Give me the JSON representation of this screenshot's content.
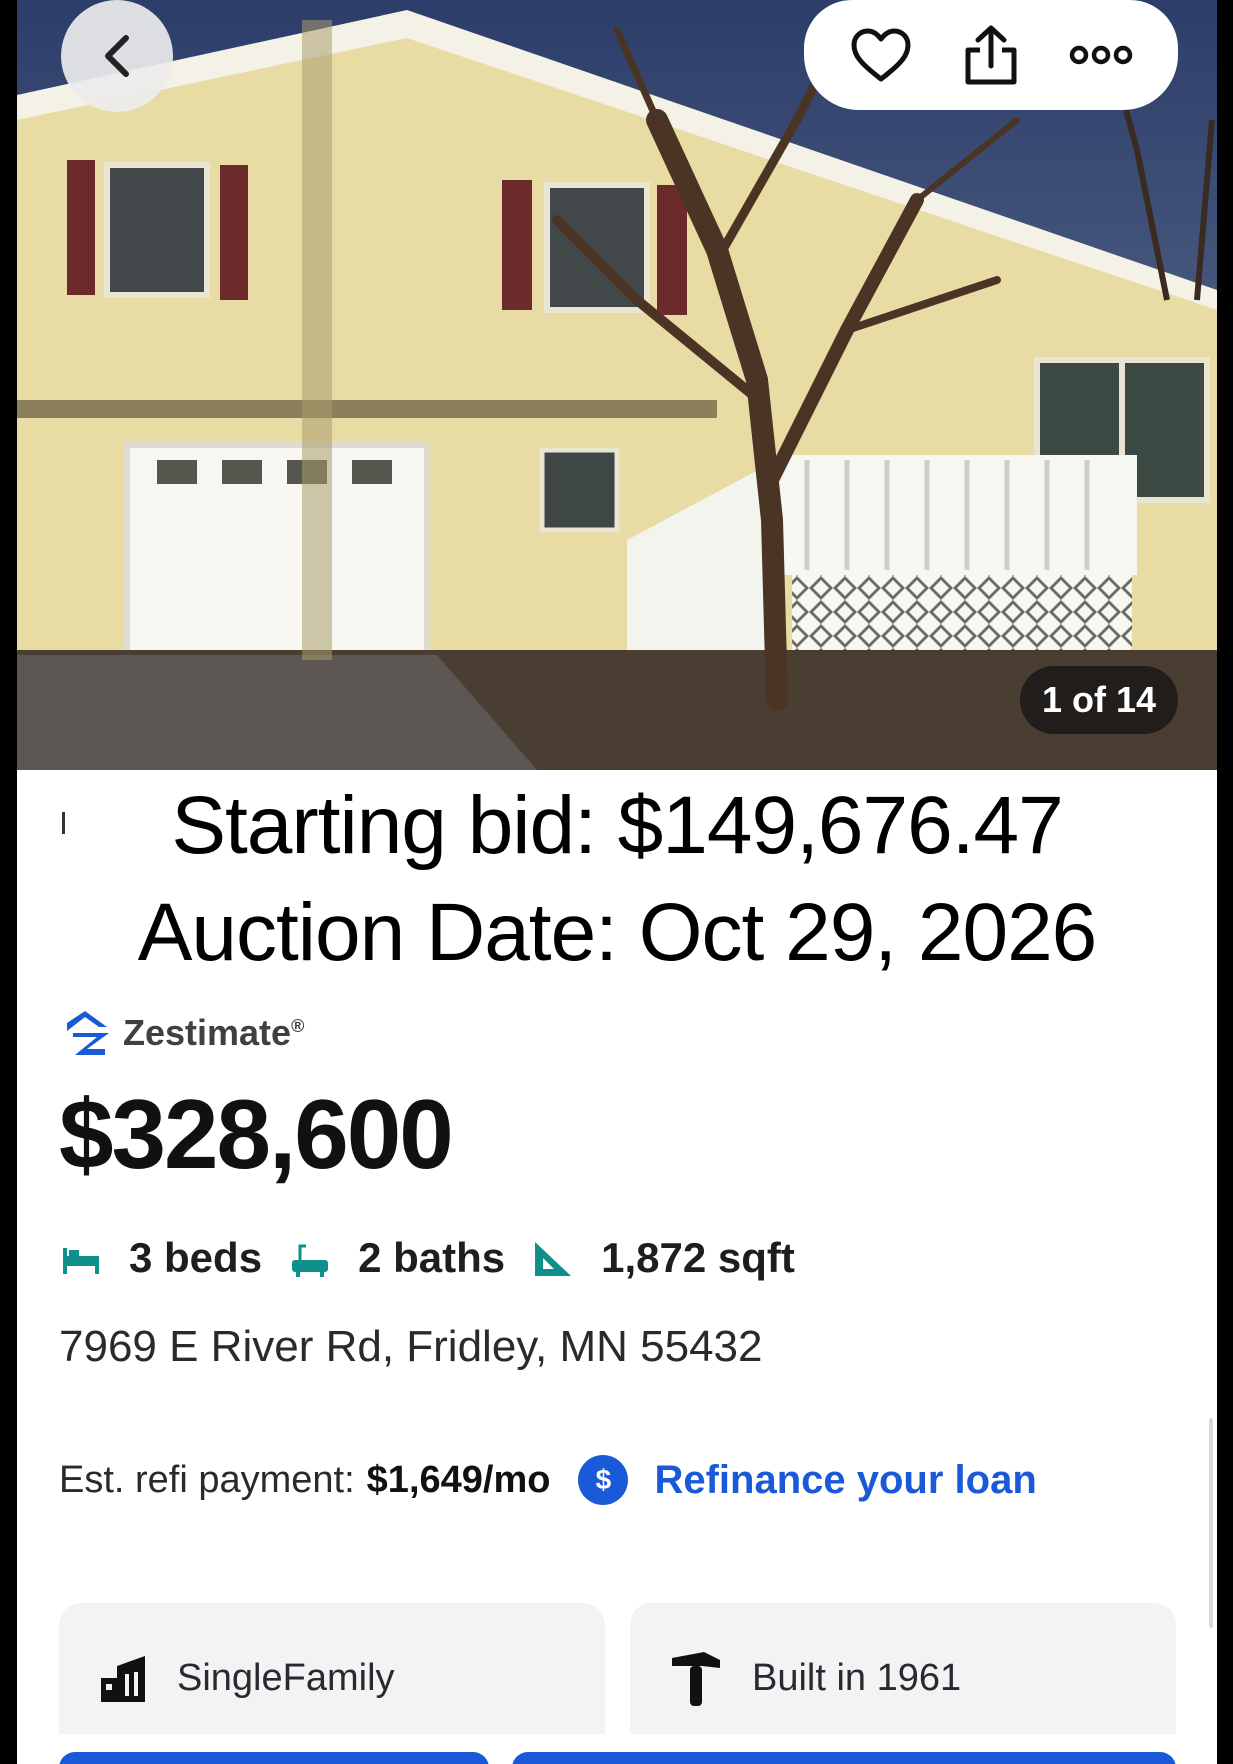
{
  "header": {
    "back_icon": "chevron-left-icon",
    "actions": [
      {
        "name": "favorite-button",
        "icon": "heart-icon"
      },
      {
        "name": "share-button",
        "icon": "share-icon"
      },
      {
        "name": "more-button",
        "icon": "more-dots-icon"
      }
    ]
  },
  "photo": {
    "counter": "1 of 14"
  },
  "overlay": {
    "line1": "Starting bid: $149,676.47",
    "line2": "Auction Date: Oct 29, 2026"
  },
  "zestimate": {
    "label": "Zestimate",
    "reg_mark": "®",
    "price": "$328,600"
  },
  "facts": {
    "beds": "3 beds",
    "baths": "2 baths",
    "sqft": "1,872 sqft"
  },
  "address": "7969 E River Rd, Fridley, MN 55432",
  "refi": {
    "label": "Est. refi payment:",
    "amount": "$1,649/mo",
    "badge": "$",
    "link": "Refinance your loan"
  },
  "tiles": {
    "type": "SingleFamily",
    "built": "Built in 1961"
  },
  "colors": {
    "accent_blue": "#1a5ad8",
    "icon_teal": "#0f8f8a"
  }
}
